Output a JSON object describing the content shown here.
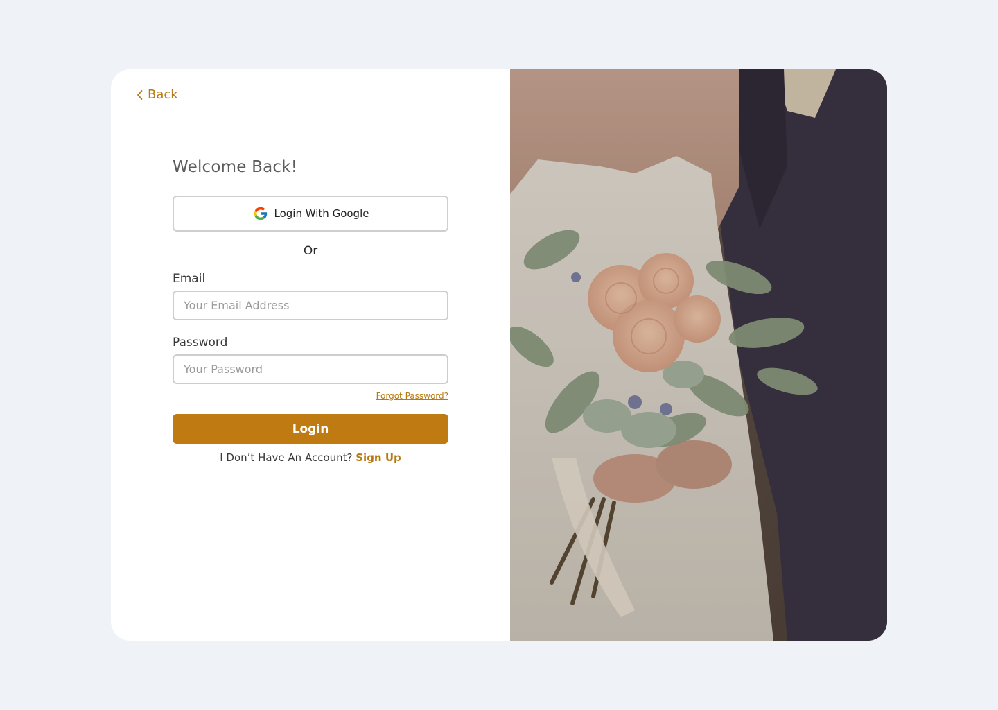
{
  "nav": {
    "back_label": "Back",
    "back_icon": "chevron-left-icon"
  },
  "login": {
    "title": "Welcome Back!",
    "google_button_label": "Login With Google",
    "google_icon": "google-icon",
    "divider_text": "Or",
    "email": {
      "label": "Email",
      "placeholder": "Your Email Address",
      "value": ""
    },
    "password": {
      "label": "Password",
      "placeholder": "Your Password",
      "value": ""
    },
    "forgot_password_label": "Forgot Password?",
    "submit_label": "Login",
    "signup_prompt": "I Don’t Have An Account?",
    "signup_link_label": "Sign Up"
  },
  "hero": {
    "image_subject": "bride-and-groom-with-bouquet-photo"
  },
  "colors": {
    "background": "#eff3f8",
    "card": "#ffffff",
    "accent": "#bf7b12",
    "link": "#b77a12",
    "title_text": "#5c5c5c",
    "input_border": "#cdcdcd"
  }
}
